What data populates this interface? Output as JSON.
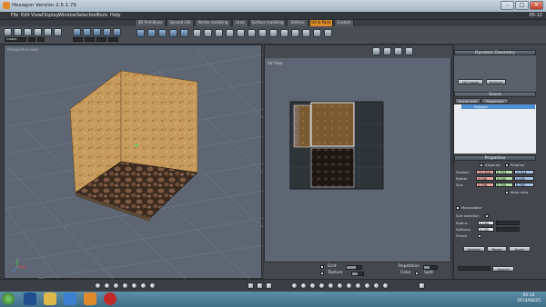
{
  "window": {
    "title": "Hexagon Version 2.5.1.79",
    "buttons": [
      "–",
      "□",
      "✕"
    ]
  },
  "menu": {
    "items": [
      "File",
      "Edit",
      "View",
      "Display",
      "Window",
      "Selection",
      "Tools",
      "Help"
    ],
    "clock": "05:12"
  },
  "tabs": [
    "3D Primitives",
    "Second Life",
    "Vertex modeling",
    "Lines",
    "Surface modeling",
    "Utilities",
    "UV & Paint",
    "Custom"
  ],
  "active_tab": "UV & Paint",
  "toolbar": {
    "mode_field": "Global"
  },
  "viewport3d": {
    "label": "Perspective view"
  },
  "uvview": {
    "label": "UV View"
  },
  "uvbar": {
    "grid_label": "Grid",
    "texture_label": "Texture",
    "repetition_label": "Repetition",
    "color_label": "Color",
    "split_label": "Split"
  },
  "panel": {
    "dynamic_geometry": {
      "title": "Dynamic Geometry",
      "dg_mode": "DG mode",
      "restrict": "Restrict"
    },
    "scene": {
      "title": "Scene",
      "tab_scene_tree": "Scene tree",
      "tab_properties": "Properties",
      "object": "Polygon"
    },
    "properties": {
      "title": "Properties",
      "absolute_label": "Absolute",
      "relative_label": "Relative",
      "position_label": "Position",
      "rotate_label": "Rotate",
      "size_label": "Size",
      "position": [
        "-12.326",
        "0.793",
        "-0.314"
      ],
      "rotate": [
        "0.000",
        "0.000",
        "0.000"
      ],
      "size": [
        "1.796",
        "0.750",
        "0.764"
      ],
      "keep_ratio": "Keep ratio",
      "manipulator_label": "Manipulator",
      "soft_selection": "Soft selection",
      "radius_label": "Radius",
      "radius_value": "0.000",
      "softness_label": "Softness",
      "softness_value": "0.000",
      "freeze_label": "Freeze",
      "btn_validate": "Validate",
      "btn_reset": "Reset",
      "btn_apply": "Apply",
      "btn_search": "Search"
    }
  },
  "taskbar": {
    "time": "05:12",
    "date": "2014/08/25"
  },
  "colors": {
    "accent": "#d98a2a",
    "viewport": "#5e6673",
    "selection": "#4f8fd1"
  }
}
